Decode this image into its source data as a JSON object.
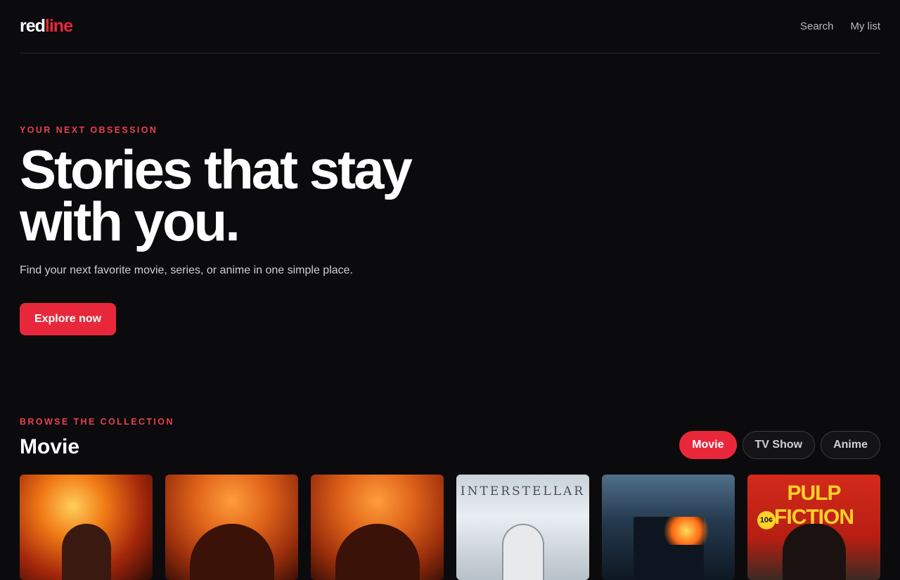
{
  "brand": {
    "logo_part1": "red",
    "logo_part2": "line"
  },
  "nav": {
    "search": "Search",
    "mylist": "My list"
  },
  "hero": {
    "eyebrow": "YOUR NEXT OBSESSION",
    "headline": "Stories that stay with you.",
    "subtext": "Find your next favorite movie, series, or anime in one simple place.",
    "cta": "Explore now"
  },
  "browse": {
    "eyebrow": "BROWSE THE COLLECTION",
    "title": "Movie",
    "tabs": [
      {
        "label": "Movie",
        "active": true
      },
      {
        "label": "TV Show",
        "active": false
      },
      {
        "label": "Anime",
        "active": false
      }
    ]
  },
  "posters": [
    {
      "title": "",
      "icon": "oppenheimer-poster"
    },
    {
      "title": "",
      "icon": "dune-part-two-poster"
    },
    {
      "title": "",
      "icon": "dune-part-two-poster"
    },
    {
      "title": "INTERSTELLAR",
      "icon": "interstellar-poster"
    },
    {
      "title": "",
      "icon": "dark-knight-poster"
    },
    {
      "title": "PULP FICTION",
      "price": "10¢",
      "icon": "pulp-fiction-poster"
    }
  ],
  "colors": {
    "accent": "#e8283a",
    "background": "#0b0b0d"
  }
}
